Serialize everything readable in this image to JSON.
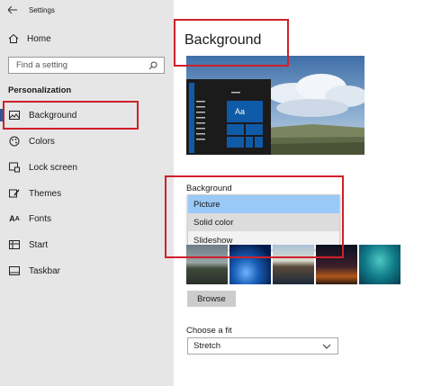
{
  "titlebar": {
    "title": "Settings"
  },
  "sidebar": {
    "home_label": "Home",
    "search_placeholder": "Find a setting",
    "section_title": "Personalization",
    "items": [
      {
        "label": "Background",
        "icon": "picture-icon"
      },
      {
        "label": "Colors",
        "icon": "palette-icon"
      },
      {
        "label": "Lock screen",
        "icon": "lock-screen-icon"
      },
      {
        "label": "Themes",
        "icon": "brush-icon"
      },
      {
        "label": "Fonts",
        "icon": "fonts-icon"
      },
      {
        "label": "Start",
        "icon": "start-icon"
      },
      {
        "label": "Taskbar",
        "icon": "taskbar-icon"
      }
    ],
    "active_item": "Background"
  },
  "main": {
    "page_title": "Background",
    "preview": {
      "tile_text": "Aa"
    },
    "background_label": "Background",
    "background_options": [
      "Picture",
      "Solid color",
      "Slideshow"
    ],
    "background_selected": "Picture",
    "browse_label": "Browse",
    "fit_label": "Choose a fit",
    "fit_value": "Stretch"
  },
  "colors": {
    "accent": "#2b579a",
    "highlight_box": "#d0202a",
    "selected_option": "#99c9f7",
    "sidebar_bg": "#e6e6e6"
  }
}
